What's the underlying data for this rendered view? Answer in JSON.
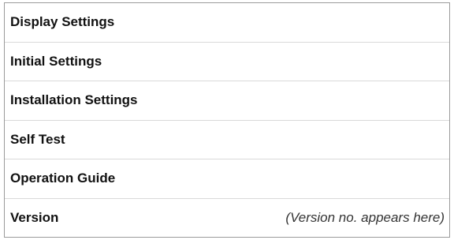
{
  "menu": {
    "items": [
      {
        "label": "Display Settings"
      },
      {
        "label": "Initial Settings"
      },
      {
        "label": "Installation Settings"
      },
      {
        "label": "Self Test"
      },
      {
        "label": "Operation Guide"
      },
      {
        "label": "Version",
        "value": "(Version no. appears here)"
      }
    ]
  }
}
